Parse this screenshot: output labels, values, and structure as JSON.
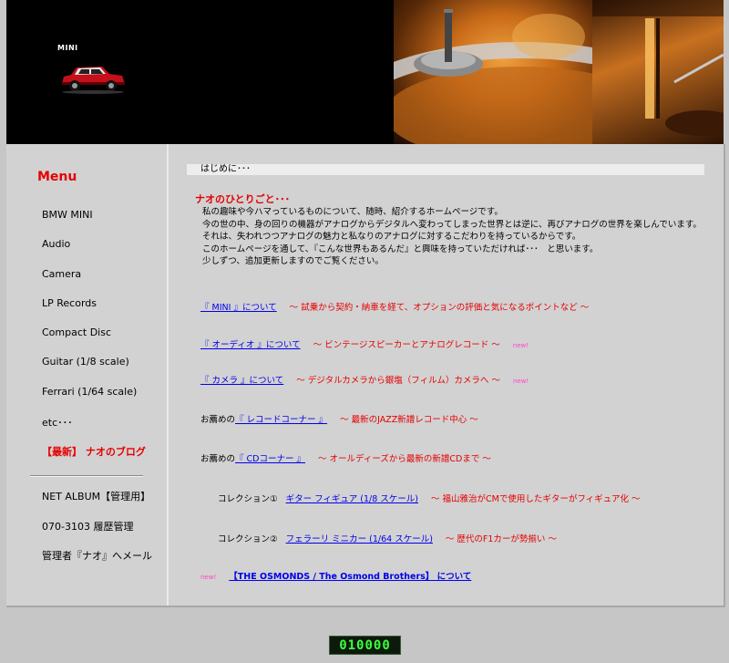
{
  "header": {
    "logo_text": "MINI"
  },
  "sidebar": {
    "title": "Menu",
    "items": [
      {
        "label": "BMW MINI"
      },
      {
        "label": "Audio"
      },
      {
        "label": "Camera"
      },
      {
        "label": "LP Records"
      },
      {
        "label": "Compact Disc"
      },
      {
        "label": "Guitar (1/8 scale)"
      },
      {
        "label": "Ferrari (1/64 scale)"
      },
      {
        "label": "etc･･･"
      },
      {
        "label": "【最新】 ナオのブログ"
      }
    ],
    "admin_items": [
      {
        "label": "NET ALBUM【管理用】"
      },
      {
        "label": "070-3103 履歴管理"
      },
      {
        "label": "管理者『ナオ』へメール"
      }
    ]
  },
  "main": {
    "intro_header": "はじめに･･･",
    "section_title": "ナオのひとりごと･･･",
    "intro_lines": [
      "私の趣味や今ハマっているものについて、随時、紹介するホームページです。",
      "今の世の中、身の回りの機器がアナログからデジタルへ変わってしまった世界とは逆に、再びアナログの世界を楽しんでいます。",
      "それは、失われつつアナログの魅力と私なりのアナログに対するこだわりを持っているからです。",
      "このホームページを通して、『こんな世界もあるんだ』と興味を持っていただければ･･･　と思います。",
      "少しずつ、追加更新しますのでご覧ください。"
    ],
    "links": {
      "mini": {
        "link": "『 MINI 』について",
        "desc": "～ 試乗から契約・納車を経て、オプションの評価と気になるポイントなど ～"
      },
      "audio": {
        "link": "『 オーディオ 』について",
        "desc": "～ ビンテージスピーカーとアナログレコード ～",
        "badge": "new!"
      },
      "camera": {
        "link": "『 カメラ 』について",
        "desc": "～ デジタルカメラから銀塩（フィルム）カメラへ ～",
        "badge": "new!"
      },
      "records": {
        "pre": "お薦めの",
        "link": "『 レコードコーナー 』",
        "desc": "～ 最新のJAZZ新譜レコード中心 ～"
      },
      "cd": {
        "pre": "お薦めの",
        "link": "『 CDコーナー 』",
        "desc": "～ オールディーズから最新の新譜CDまで ～"
      },
      "collection1": {
        "pre": "コレクション①",
        "link": "ギター フィギュア (1/8 スケール)",
        "desc": "～ 福山雅治がCMで使用したギターがフィギュア化 ～"
      },
      "collection2": {
        "pre": "コレクション②",
        "link": "フェラーリ ミニカー (1/64 スケール)",
        "desc": "～ 歴代のF1カーが勢揃い ～"
      },
      "osmonds": {
        "badge": "new!",
        "link": "【THE OSMONDS / The Osmond Brothers】 について"
      }
    }
  },
  "counter": {
    "value": "010000"
  }
}
